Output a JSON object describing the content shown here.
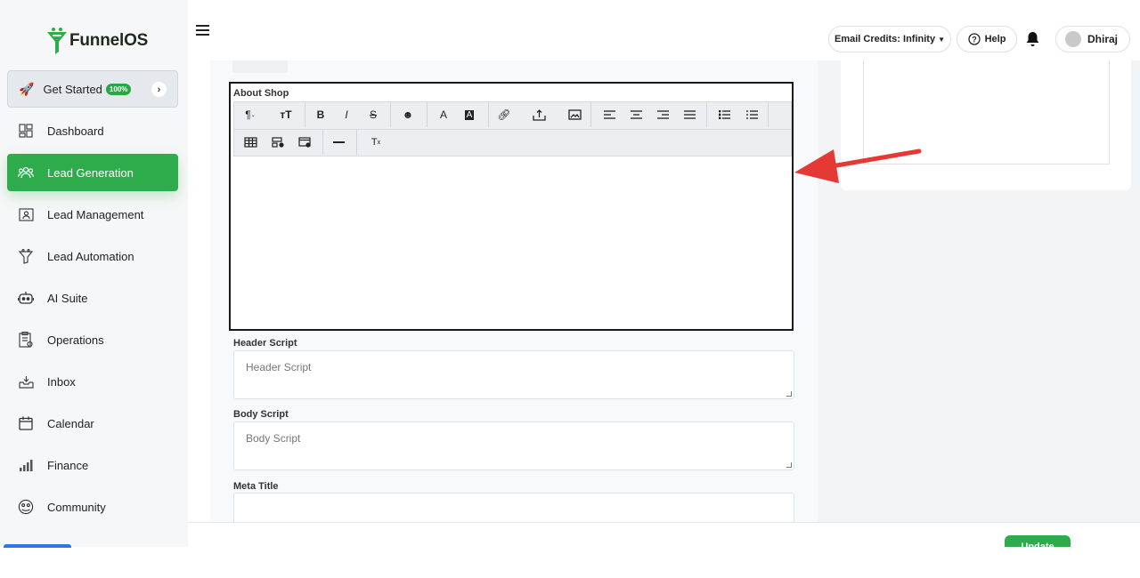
{
  "brand": {
    "name": "FunnelOS"
  },
  "sidebar": {
    "get_started": {
      "label": "Get Started",
      "badge": "100%"
    },
    "items": [
      {
        "label": "Dashboard",
        "icon": "dashboard-icon"
      },
      {
        "label": "Lead Generation",
        "icon": "users-icon",
        "active": true
      },
      {
        "label": "Lead Management",
        "icon": "contact-card-icon"
      },
      {
        "label": "Lead Automation",
        "icon": "funnel-icon"
      },
      {
        "label": "AI Suite",
        "icon": "robot-icon"
      },
      {
        "label": "Operations",
        "icon": "clipboard-icon"
      },
      {
        "label": "Inbox",
        "icon": "inbox-icon"
      },
      {
        "label": "Calendar",
        "icon": "calendar-icon"
      },
      {
        "label": "Finance",
        "icon": "chart-icon"
      },
      {
        "label": "Community",
        "icon": "community-icon"
      }
    ]
  },
  "topbar": {
    "credits": "Email Credits: Infinity",
    "help": "Help",
    "user": "Dhiraj"
  },
  "form": {
    "about_shop_label": "About Shop",
    "header_script_label": "Header Script",
    "header_script_placeholder": "Header Script",
    "body_script_label": "Body Script",
    "body_script_placeholder": "Body Script",
    "meta_title_label": "Meta Title"
  },
  "toolbar": {
    "row1": [
      "paragraph",
      "font-size",
      "bold",
      "italic",
      "strikethrough",
      "emoji",
      "text-color",
      "background-color",
      "link",
      "upload",
      "image",
      "align-left",
      "align-center",
      "align-right",
      "justify",
      "bullet-list",
      "numbered-list"
    ],
    "row2": [
      "table",
      "table-cells",
      "table-style",
      "horizontal-rule",
      "clear-format"
    ]
  },
  "footer": {
    "update_label": "Update"
  },
  "colors": {
    "accent": "#2eac4c",
    "arrow": "#e53935"
  }
}
